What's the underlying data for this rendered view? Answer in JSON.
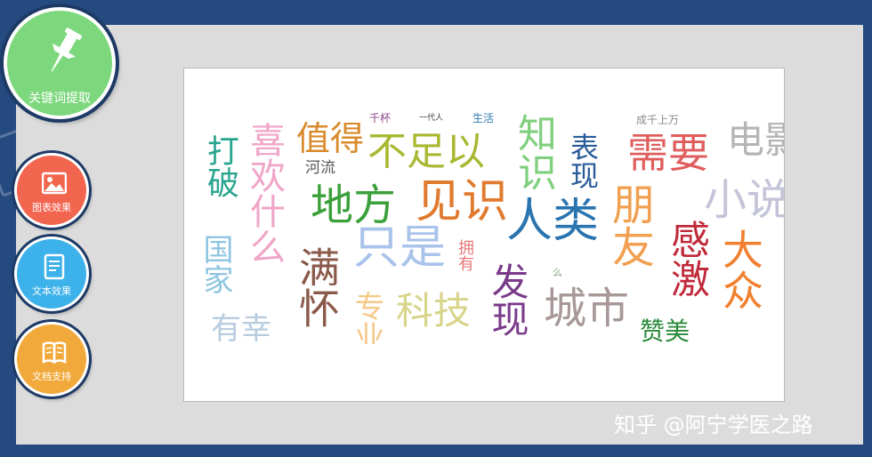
{
  "sidebar": {
    "main_button": {
      "label": "关键词提取",
      "color": "#7dd87d",
      "icon": "pushpin-icon"
    },
    "buttons": [
      {
        "label": "图表效果",
        "color": "#f2654f",
        "icon": "image-icon"
      },
      {
        "label": "文本效果",
        "color": "#3db1ea",
        "icon": "document-icon"
      },
      {
        "label": "文档支持",
        "color": "#f2a93b",
        "icon": "book-icon"
      }
    ]
  },
  "wordcloud": {
    "words": [
      "打破",
      "喜欢什么",
      "值得",
      "河流",
      "千杯",
      "一代人",
      "生活",
      "不足以",
      "知识",
      "表现",
      "需要",
      "电影",
      "地方",
      "见识",
      "人类",
      "朋友",
      "小说",
      "国家",
      "满怀",
      "只是",
      "拥有",
      "发现",
      "感激",
      "大众",
      "有幸",
      "专业",
      "科技",
      "城市",
      "赞美",
      "成千上万",
      "么"
    ]
  },
  "watermark": {
    "text": "知乎 @阿宁学医之路"
  }
}
